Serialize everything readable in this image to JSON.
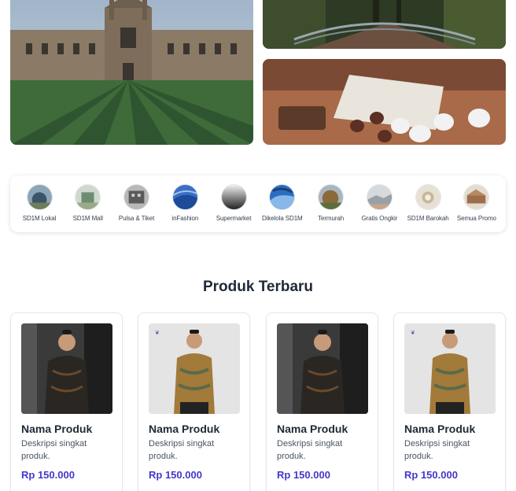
{
  "categories": [
    {
      "label": "SD1M Lokal",
      "icon": "local-icon"
    },
    {
      "label": "SD1M Mall",
      "icon": "mall-icon"
    },
    {
      "label": "Pulsa & Tiket",
      "icon": "ticket-icon"
    },
    {
      "label": "inFashion",
      "icon": "fashion-icon"
    },
    {
      "label": "Supermarket",
      "icon": "supermarket-icon"
    },
    {
      "label": "Dikelola SD1M",
      "icon": "managed-icon"
    },
    {
      "label": "Termurah",
      "icon": "cheapest-icon"
    },
    {
      "label": "Gratis Ongkir",
      "icon": "free-shipping-icon"
    },
    {
      "label": "SD1M Barokah",
      "icon": "barokah-icon"
    },
    {
      "label": "Semua Promo",
      "icon": "promo-icon"
    }
  ],
  "section": {
    "title": "Produk Terbaru"
  },
  "products": [
    {
      "name": "Nama Produk",
      "description": "Deskripsi singkat produk.",
      "price": "Rp 150.000"
    },
    {
      "name": "Nama Produk",
      "description": "Deskripsi singkat produk.",
      "price": "Rp 150.000"
    },
    {
      "name": "Nama Produk",
      "description": "Deskripsi singkat produk.",
      "price": "Rp 150.000"
    },
    {
      "name": "Nama Produk",
      "description": "Deskripsi singkat produk.",
      "price": "Rp 150.000"
    }
  ],
  "colors": {
    "price": "#4338ca",
    "title": "#1f2937"
  }
}
